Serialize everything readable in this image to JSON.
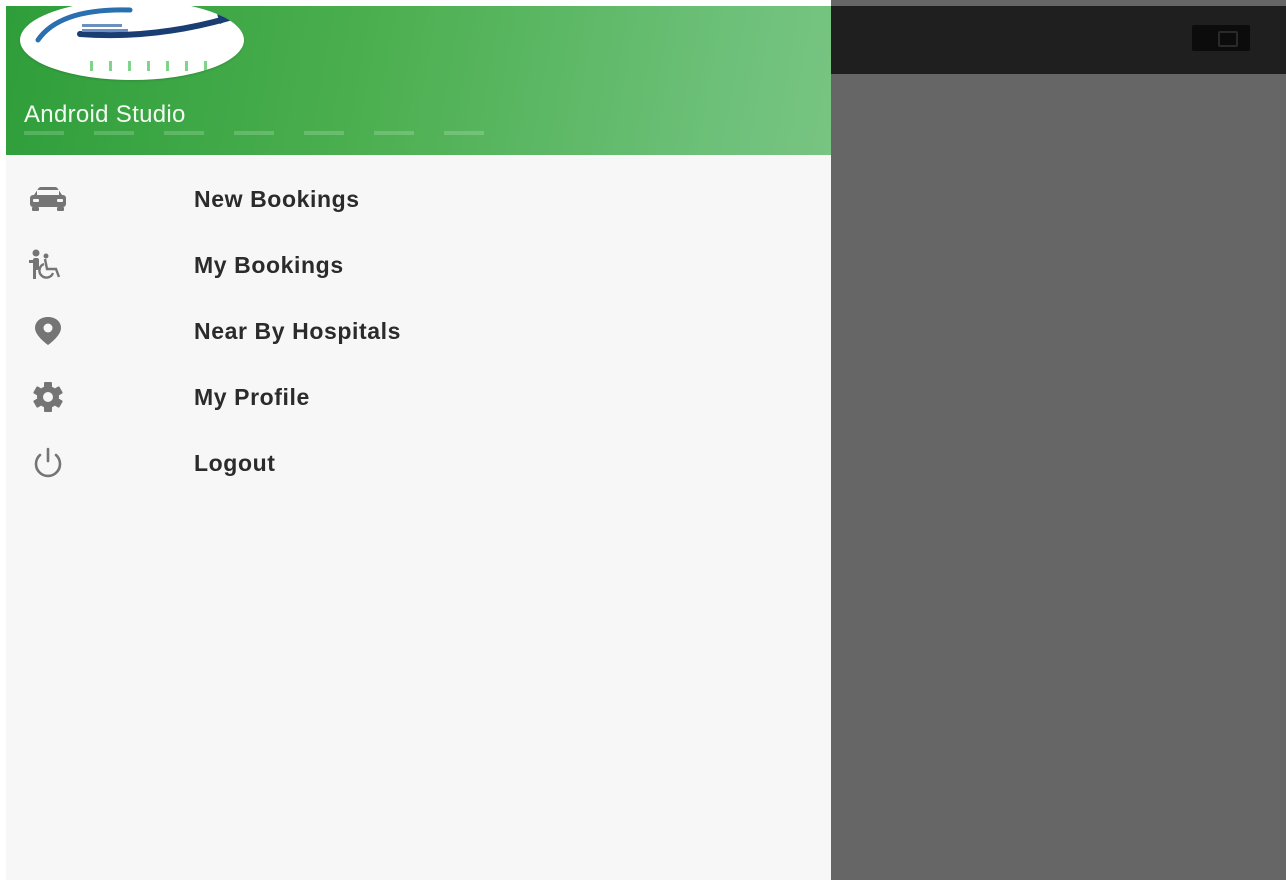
{
  "app": {
    "header_title": "Android Studio"
  },
  "menu": {
    "items": [
      {
        "label": "New Bookings",
        "icon": "car-icon"
      },
      {
        "label": "My Bookings",
        "icon": "wheelchair-icon"
      },
      {
        "label": "Near By Hospitals",
        "icon": "location-pin-icon"
      },
      {
        "label": "My Profile",
        "icon": "gear-icon"
      },
      {
        "label": "Logout",
        "icon": "power-icon"
      }
    ]
  },
  "colors": {
    "header_green": "#4caf50",
    "drawer_bg": "#f7f7f7",
    "scrim": "#666666",
    "topbar": "#1f1f1f",
    "icon_gray": "#757575",
    "label_text": "#2b2b2b"
  }
}
